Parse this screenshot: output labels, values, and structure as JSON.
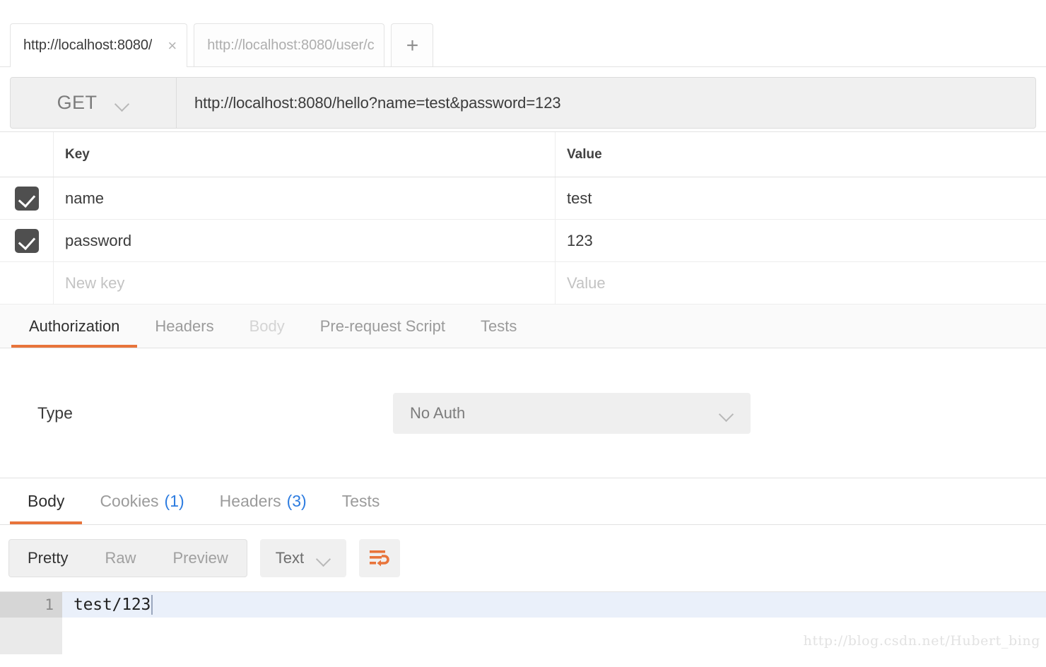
{
  "tabs": {
    "items": [
      {
        "label": "http://localhost:8080/",
        "active": true,
        "close": "×"
      },
      {
        "label": "http://localhost:8080/user/c",
        "active": false
      }
    ],
    "new_tab_label": "+"
  },
  "request": {
    "method": "GET",
    "url": "http://localhost:8080/hello?name=test&password=123"
  },
  "params": {
    "headers": {
      "key": "Key",
      "value": "Value"
    },
    "rows": [
      {
        "checked": true,
        "key": "name",
        "value": "test"
      },
      {
        "checked": true,
        "key": "password",
        "value": "123"
      }
    ],
    "new_row": {
      "key_placeholder": "New key",
      "value_placeholder": "Value"
    }
  },
  "request_tabs": {
    "items": [
      {
        "label": "Authorization",
        "state": "active"
      },
      {
        "label": "Headers",
        "state": "normal"
      },
      {
        "label": "Body",
        "state": "disabled"
      },
      {
        "label": "Pre-request Script",
        "state": "normal"
      },
      {
        "label": "Tests",
        "state": "normal"
      }
    ]
  },
  "auth": {
    "type_label": "Type",
    "type_value": "No Auth"
  },
  "response_tabs": {
    "items": [
      {
        "label": "Body",
        "count": "",
        "state": "active"
      },
      {
        "label": "Cookies",
        "count": "(1)",
        "state": "normal"
      },
      {
        "label": "Headers",
        "count": "(3)",
        "state": "normal"
      },
      {
        "label": "Tests",
        "count": "",
        "state": "normal"
      }
    ]
  },
  "response_toolbar": {
    "view_modes": [
      {
        "label": "Pretty",
        "active": true
      },
      {
        "label": "Raw",
        "active": false
      },
      {
        "label": "Preview",
        "active": false
      }
    ],
    "format": "Text",
    "wrap_icon": "word-wrap-icon"
  },
  "response_body": {
    "line_number": "1",
    "text": "test/123"
  },
  "watermark": "http://blog.csdn.net/Hubert_bing",
  "colors": {
    "accent": "#e8743b",
    "link": "#2d7ce0",
    "checkbox": "#4f4f4f",
    "active_line": "#eaf0fa"
  }
}
